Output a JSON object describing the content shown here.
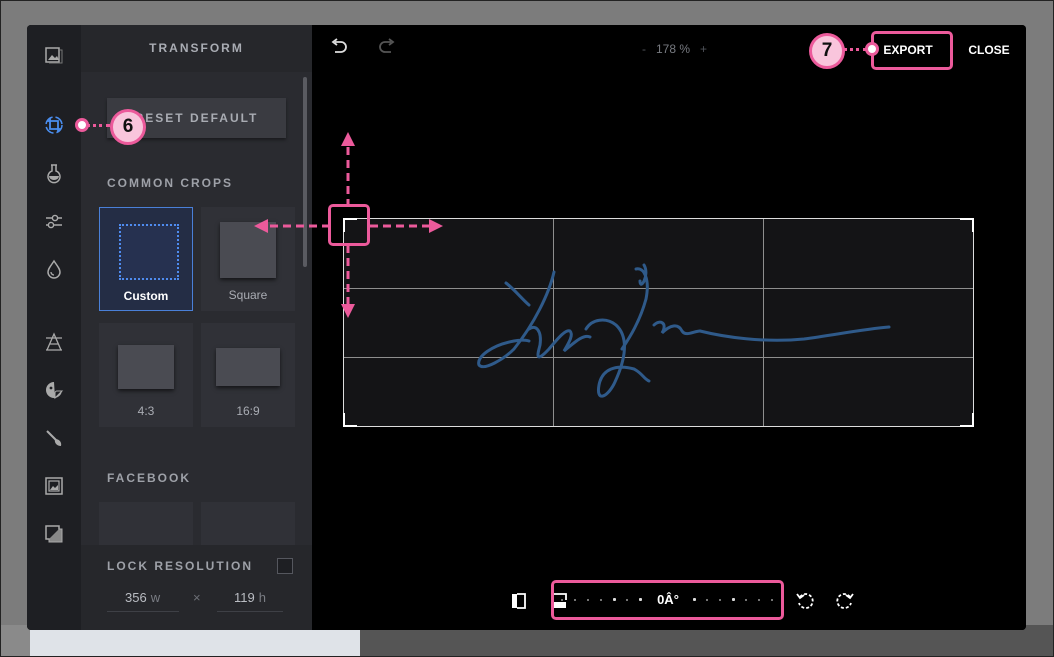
{
  "panel": {
    "title": "TRANSFORM",
    "reset_label": "RESET DEFAULT",
    "common_crops_label": "COMMON CROPS",
    "crops": [
      {
        "label": "Custom",
        "selected": true
      },
      {
        "label": "Square",
        "selected": false
      },
      {
        "label": "4:3",
        "selected": false
      },
      {
        "label": "16:9",
        "selected": false
      }
    ],
    "facebook_label": "FACEBOOK",
    "lock_resolution_label": "LOCK RESOLUTION",
    "width_value": "356",
    "width_unit": "w",
    "times": "×",
    "height_value": "119",
    "height_unit": "h"
  },
  "rail_icons": [
    "image-icon",
    "crop-icon",
    "flask-icon",
    "sliders-icon",
    "drop-icon",
    "text-icon",
    "sticker-icon",
    "brush-icon",
    "frame-icon",
    "overlay-icon"
  ],
  "toolbar": {
    "zoom_minus": "-",
    "zoom_value": "178 %",
    "zoom_plus": "+",
    "export_label": "EXPORT",
    "close_label": "CLOSE"
  },
  "rotation": {
    "value": "0Â°"
  },
  "callouts": {
    "six": "6",
    "seven": "7"
  },
  "colors": {
    "accent": "#ec5a9b",
    "selection_blue": "#4a80d8",
    "signature": "#2f5a8a"
  }
}
